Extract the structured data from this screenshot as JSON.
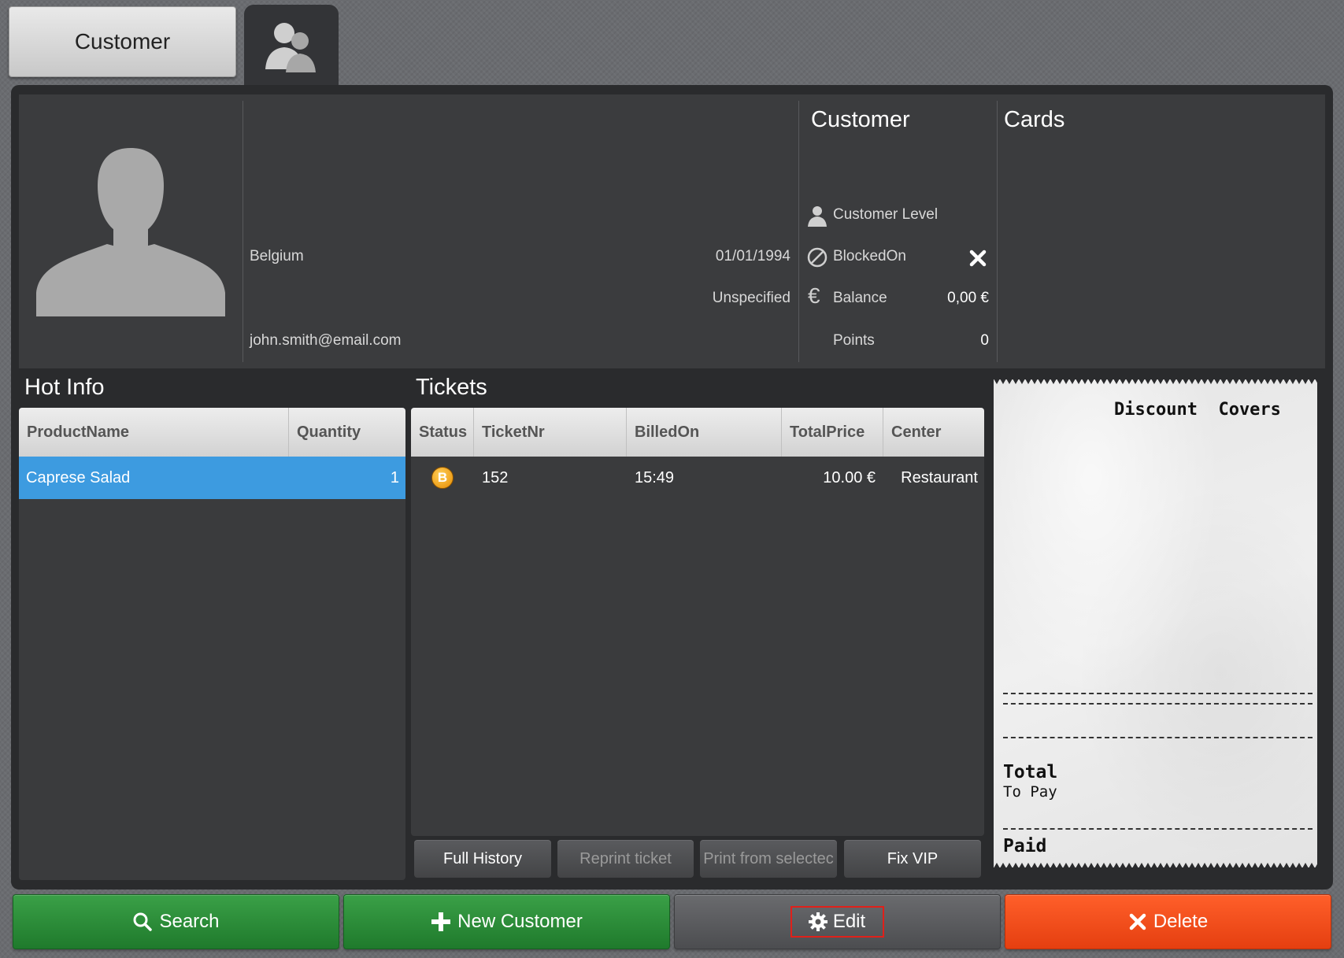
{
  "top_tabs": {
    "customer_label": "Customer",
    "group_icon": "customers-group-icon"
  },
  "customer_info": {
    "country": "Belgium",
    "email": "john.smith@email.com",
    "birthdate": "01/01/1994",
    "gender": "Unspecified"
  },
  "customer_section": {
    "title": "Customer",
    "level_label": "Customer Level",
    "blocked_label": "BlockedOn",
    "balance_label": "Balance",
    "balance_value": "0,00 €",
    "points_label": "Points",
    "points_value": "0"
  },
  "cards_section": {
    "title": "Cards"
  },
  "hot_info": {
    "title": "Hot Info",
    "columns": [
      "ProductName",
      "Quantity"
    ],
    "rows": [
      {
        "product": "Caprese Salad",
        "quantity": "1"
      }
    ]
  },
  "tickets": {
    "title": "Tickets",
    "columns": [
      "Status",
      "TicketNr",
      "BilledOn",
      "TotalPrice",
      "Center"
    ],
    "rows": [
      {
        "status": "B",
        "ticket_nr": "152",
        "billed_on": "15:49",
        "total_price": "10.00 €",
        "center": "Restaurant"
      }
    ],
    "buttons": {
      "full_history": "Full History",
      "reprint": "Reprint ticket",
      "print_from_selected": "Print from selectec",
      "fix_vip": "Fix VIP"
    }
  },
  "receipt": {
    "header": "Discount  Covers",
    "total_label": "Total",
    "to_pay_label": "To Pay",
    "paid_label": "Paid"
  },
  "bottom_bar": {
    "search": "Search",
    "new_customer": "New Customer",
    "edit": "Edit",
    "delete": "Delete"
  },
  "colors": {
    "selected_row": "#3d9be0",
    "green": "#2a8f3a",
    "orange": "#f4501c",
    "status_badge": "#f0a020"
  }
}
